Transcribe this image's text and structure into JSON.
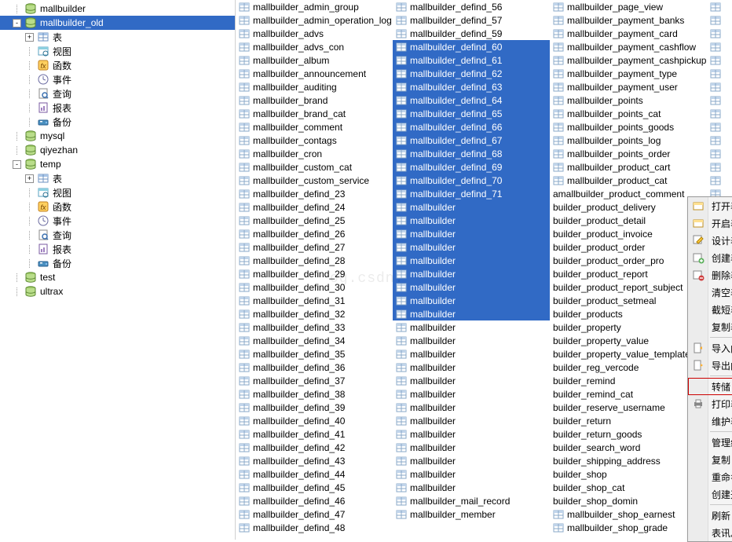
{
  "tree": [
    {
      "depth": 1,
      "toggle": "",
      "icon": "db",
      "label": "mallbuilder"
    },
    {
      "depth": 1,
      "toggle": "-",
      "icon": "db",
      "label": "mallbuilder_old",
      "sel": true
    },
    {
      "depth": 2,
      "toggle": "+",
      "icon": "tables",
      "label": "表"
    },
    {
      "depth": 2,
      "toggle": " ",
      "icon": "views",
      "label": "视图"
    },
    {
      "depth": 2,
      "toggle": " ",
      "icon": "fx",
      "label": "函数"
    },
    {
      "depth": 2,
      "toggle": " ",
      "icon": "events",
      "label": "事件"
    },
    {
      "depth": 2,
      "toggle": " ",
      "icon": "query",
      "label": "查询"
    },
    {
      "depth": 2,
      "toggle": " ",
      "icon": "reports",
      "label": "报表"
    },
    {
      "depth": 2,
      "toggle": " ",
      "icon": "backup",
      "label": "备份"
    },
    {
      "depth": 1,
      "toggle": "",
      "icon": "db",
      "label": "mysql"
    },
    {
      "depth": 1,
      "toggle": "",
      "icon": "db",
      "label": "qiyezhan"
    },
    {
      "depth": 1,
      "toggle": "-",
      "icon": "db",
      "label": "temp"
    },
    {
      "depth": 2,
      "toggle": "+",
      "icon": "tables",
      "label": "表"
    },
    {
      "depth": 2,
      "toggle": " ",
      "icon": "views",
      "label": "视图"
    },
    {
      "depth": 2,
      "toggle": " ",
      "icon": "fx",
      "label": "函数"
    },
    {
      "depth": 2,
      "toggle": " ",
      "icon": "events",
      "label": "事件"
    },
    {
      "depth": 2,
      "toggle": " ",
      "icon": "query",
      "label": "查询"
    },
    {
      "depth": 2,
      "toggle": " ",
      "icon": "reports",
      "label": "报表"
    },
    {
      "depth": 2,
      "toggle": " ",
      "icon": "backup",
      "label": "备份"
    },
    {
      "depth": 1,
      "toggle": "",
      "icon": "db",
      "label": "test"
    },
    {
      "depth": 1,
      "toggle": "",
      "icon": "db",
      "label": "ultrax"
    }
  ],
  "columns": [
    [
      {
        "t": "mallbuilder_admin_group"
      },
      {
        "t": "mallbuilder_admin_operation_log"
      },
      {
        "t": "mallbuilder_advs"
      },
      {
        "t": "mallbuilder_advs_con"
      },
      {
        "t": "mallbuilder_album"
      },
      {
        "t": "mallbuilder_announcement"
      },
      {
        "t": "mallbuilder_auditing"
      },
      {
        "t": "mallbuilder_brand"
      },
      {
        "t": "mallbuilder_brand_cat"
      },
      {
        "t": "mallbuilder_comment"
      },
      {
        "t": "mallbuilder_contags"
      },
      {
        "t": "mallbuilder_cron"
      },
      {
        "t": "mallbuilder_custom_cat"
      },
      {
        "t": "mallbuilder_custom_service"
      },
      {
        "t": "mallbuilder_defind_23"
      },
      {
        "t": "mallbuilder_defind_24"
      },
      {
        "t": "mallbuilder_defind_25"
      },
      {
        "t": "mallbuilder_defind_26"
      },
      {
        "t": "mallbuilder_defind_27"
      },
      {
        "t": "mallbuilder_defind_28"
      },
      {
        "t": "mallbuilder_defind_29"
      },
      {
        "t": "mallbuilder_defind_30"
      },
      {
        "t": "mallbuilder_defind_31"
      },
      {
        "t": "mallbuilder_defind_32"
      },
      {
        "t": "mallbuilder_defind_33"
      },
      {
        "t": "mallbuilder_defind_34"
      },
      {
        "t": "mallbuilder_defind_35"
      },
      {
        "t": "mallbuilder_defind_36"
      },
      {
        "t": "mallbuilder_defind_37"
      },
      {
        "t": "mallbuilder_defind_38"
      },
      {
        "t": "mallbuilder_defind_39"
      },
      {
        "t": "mallbuilder_defind_40"
      },
      {
        "t": "mallbuilder_defind_41"
      },
      {
        "t": "mallbuilder_defind_42"
      },
      {
        "t": "mallbuilder_defind_43"
      },
      {
        "t": "mallbuilder_defind_44"
      },
      {
        "t": "mallbuilder_defind_45"
      },
      {
        "t": "mallbuilder_defind_46"
      },
      {
        "t": "mallbuilder_defind_47"
      },
      {
        "t": "mallbuilder_defind_48"
      }
    ],
    [
      {
        "t": "mallbuilder_defind_56"
      },
      {
        "t": "mallbuilder_defind_57"
      },
      {
        "t": "mallbuilder_defind_59"
      },
      {
        "t": "mallbuilder_defind_60",
        "sel": true
      },
      {
        "t": "mallbuilder_defind_61",
        "sel": true
      },
      {
        "t": "mallbuilder_defind_62",
        "sel": true
      },
      {
        "t": "mallbuilder_defind_63",
        "sel": true
      },
      {
        "t": "mallbuilder_defind_64",
        "sel": true
      },
      {
        "t": "mallbuilder_defind_65",
        "sel": true
      },
      {
        "t": "mallbuilder_defind_66",
        "sel": true
      },
      {
        "t": "mallbuilder_defind_67",
        "sel": true
      },
      {
        "t": "mallbuilder_defind_68",
        "sel": true
      },
      {
        "t": "mallbuilder_defind_69",
        "sel": true
      },
      {
        "t": "mallbuilder_defind_70",
        "sel": true
      },
      {
        "t": "mallbuilder_defind_71",
        "sel": true
      },
      {
        "t": "mallbuilder",
        "sel": true,
        "trunc": true
      },
      {
        "t": "mallbuilder",
        "sel": true,
        "trunc": true
      },
      {
        "t": "mallbuilder",
        "sel": true,
        "trunc": true
      },
      {
        "t": "mallbuilder",
        "sel": true,
        "trunc": true
      },
      {
        "t": "mallbuilder",
        "sel": true,
        "trunc": true
      },
      {
        "t": "mallbuilder",
        "sel": true,
        "trunc": true
      },
      {
        "t": "mallbuilder",
        "sel": true,
        "trunc": true
      },
      {
        "t": "mallbuilder",
        "sel": true,
        "trunc": true
      },
      {
        "t": "mallbuilder",
        "sel": true,
        "trunc": true
      },
      {
        "t": "mallbuilder",
        "trunc": true
      },
      {
        "t": "mallbuilder",
        "trunc": true
      },
      {
        "t": "mallbuilder",
        "trunc": true
      },
      {
        "t": "mallbuilder",
        "trunc": true
      },
      {
        "t": "mallbuilder",
        "trunc": true
      },
      {
        "t": "mallbuilder",
        "trunc": true
      },
      {
        "t": "mallbuilder",
        "trunc": true
      },
      {
        "t": "mallbuilder",
        "trunc": true
      },
      {
        "t": "mallbuilder",
        "trunc": true
      },
      {
        "t": "mallbuilder",
        "trunc": true
      },
      {
        "t": "mallbuilder",
        "trunc": true
      },
      {
        "t": "mallbuilder",
        "trunc": true
      },
      {
        "t": "mallbuilder",
        "trunc": true
      },
      {
        "t": "mallbuilder_mail_record"
      },
      {
        "t": "mallbuilder_member"
      }
    ],
    [
      {
        "t": "mallbuilder_page_view"
      },
      {
        "t": "mallbuilder_payment_banks"
      },
      {
        "t": "mallbuilder_payment_card"
      },
      {
        "t": "mallbuilder_payment_cashflow"
      },
      {
        "t": "mallbuilder_payment_cashpickup"
      },
      {
        "t": "mallbuilder_payment_type"
      },
      {
        "t": "mallbuilder_payment_user"
      },
      {
        "t": "mallbuilder_points"
      },
      {
        "t": "mallbuilder_points_cat"
      },
      {
        "t": "mallbuilder_points_goods"
      },
      {
        "t": "mallbuilder_points_log"
      },
      {
        "t": "mallbuilder_points_order"
      },
      {
        "t": "mallbuilder_product_cart"
      },
      {
        "t": "mallbuilder_product_cat"
      },
      {
        "t": "mallbuilder_product_comment",
        "trunc": true,
        "pre": "a"
      },
      {
        "t": "builder_product_delivery",
        "trunc": true
      },
      {
        "t": "builder_product_detail",
        "trunc": true
      },
      {
        "t": "builder_product_invoice",
        "trunc": true
      },
      {
        "t": "builder_product_order",
        "trunc": true
      },
      {
        "t": "builder_product_order_pro",
        "trunc": true
      },
      {
        "t": "builder_product_report",
        "trunc": true
      },
      {
        "t": "builder_product_report_subject",
        "trunc": true
      },
      {
        "t": "builder_product_setmeal",
        "trunc": true
      },
      {
        "t": "builder_products",
        "trunc": true
      },
      {
        "t": "builder_property",
        "trunc": true
      },
      {
        "t": "builder_property_value",
        "trunc": true
      },
      {
        "t": "builder_property_value_template",
        "trunc": true
      },
      {
        "t": "builder_reg_vercode",
        "trunc": true
      },
      {
        "t": "builder_remind",
        "trunc": true
      },
      {
        "t": "builder_remind_cat",
        "trunc": true
      },
      {
        "t": "builder_reserve_username",
        "trunc": true
      },
      {
        "t": "builder_return",
        "trunc": true
      },
      {
        "t": "builder_return_goods",
        "trunc": true
      },
      {
        "t": "builder_search_word",
        "trunc": true
      },
      {
        "t": "builder_shipping_address",
        "trunc": true
      },
      {
        "t": "builder_shop",
        "trunc": true
      },
      {
        "t": "builder_shop_cat",
        "trunc": true
      },
      {
        "t": "builder_shop_domin",
        "trunc": true
      },
      {
        "t": "mallbuilder_shop_earnest"
      },
      {
        "t": "mallbuilder_shop_grade"
      }
    ]
  ],
  "col4": 16,
  "ctx": [
    {
      "type": "item",
      "icon": "open",
      "label": "打开表(O)"
    },
    {
      "type": "item",
      "icon": "open-fast",
      "label": "开启表 (快速)"
    },
    {
      "type": "item",
      "icon": "design",
      "label": "设计表(E)"
    },
    {
      "type": "item",
      "icon": "new",
      "label": "创建表(N)"
    },
    {
      "type": "item",
      "icon": "delete",
      "label": "删除表(D)"
    },
    {
      "type": "item",
      "label": "清空表"
    },
    {
      "type": "item",
      "label": "截短表"
    },
    {
      "type": "item",
      "label": "复制表"
    },
    {
      "type": "sep"
    },
    {
      "type": "item",
      "icon": "import",
      "label": "导入向导(I)"
    },
    {
      "type": "item",
      "icon": "export",
      "label": "导出向导(X)"
    },
    {
      "type": "sep"
    },
    {
      "type": "item",
      "label": "转储 SQL 文件",
      "hl": true
    },
    {
      "type": "item",
      "icon": "print",
      "label": "打印表"
    },
    {
      "type": "item",
      "label": "维护表",
      "sub": true
    },
    {
      "type": "sep"
    },
    {
      "type": "item",
      "label": "管理组",
      "sub": true
    },
    {
      "type": "item",
      "label": "复制"
    },
    {
      "type": "item",
      "label": "重命名"
    },
    {
      "type": "item",
      "label": "创建开启表快捷方式..."
    },
    {
      "type": "sep"
    },
    {
      "type": "item",
      "label": "刷新"
    },
    {
      "type": "item",
      "label": "表讯息"
    }
  ],
  "watermark": "og.csdn."
}
